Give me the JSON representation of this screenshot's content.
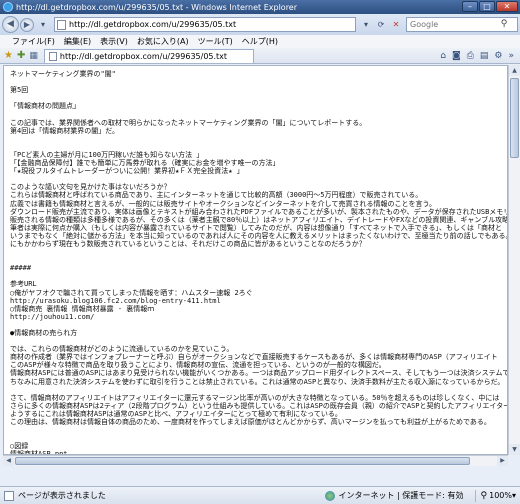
{
  "window": {
    "title": "http://dl.getdropbox.com/u/299635/05.txt - Windows Internet Explorer"
  },
  "address": {
    "url": "http://dl.getdropbox.com/u/299635/05.txt",
    "search_placeholder": "Google"
  },
  "menu": [
    "ファイル(F)",
    "編集(E)",
    "表示(V)",
    "お気に入り(A)",
    "ツール(T)",
    "ヘルプ(H)"
  ],
  "tab": {
    "label": "http://dl.getdropbox.com/u/299635/05.txt"
  },
  "document": {
    "lines": [
      "ネットマーケティング業界の\"闇\"",
      "",
      "第5回",
      "",
      "「情報商材の問題点」",
      "",
      "この記事では、業界関係者への取材で明らかになったネットマーケティング業界の「闇」についてレポートする。",
      "第4回は「情報商材業界の闇」だ。",
      "",
      "",
      "「PCど素人の主婦が月に100万円稼いだ誰も知らない方法 」",
      "「【金融商品保障付】誰でも簡単に万馬券が取れる（確実にお金を増やす唯一の方法」",
      "「★現役フルタイムトレーダーがついに公開！業界初★ＦＸ完全投資法★ 」",
      "",
      "このような謳い文句を見かけた事はないだろうか？",
      "これらは情報商材と呼ばれている商品であり、主にインターネットを通じて比較的高額（3000円～5万円程度）で販売されている。",
      "広義では書籍も情報商材と言えるが、一般的には販売サイトやオークションなどインターネットを介して売買される情報のことを言う。",
      "ダウンロード販売が主流であり、実体は画像とテキストが組み合わされたPDFファイルであることが多いが、製本されたものや、データが保存されたUSBメモリやCD",
      "販売される情報の種類は多種多様であるが、その多くは（薬者主観で80％以上）はネットアフィリエイト、デイトレードやFXなどの投資関連、ギャンブル攻略方法",
      "筆者は実際に何点か購入（もしくは内容が暴露されているサイトで閲覧）してみたのだが、内容は想像通り「すべてネットで入手できる」、もしくは「商材と",
      "いうまでもなく「絶対に儲かる方法」を本当に知っているのであれば人にその内容を人に教えるメリットはまったくないわけで、至極当たり前の話しでもある。",
      "にもかかわらず現在もう数販売されているということは、それだけこの商品に皆があるということなのだろうか？",
      "",
      "",
      "#####",
      "",
      "参考URL",
      "○俺がヤフオクで騙されて買ってしまった情報を晒す：ハムスター速報 2ろぐ",
      "http://urasoku.blog106.fc2.com/blog-entry-411.html",
      "○情報商売 裏情報 情報商材暴露 - 裏情報ｍ",
      "http://jouhou11.com/",
      "",
      "●情報商材の売られ方",
      "",
      "では、これらの情報商材がどのように流通しているのかを見ていこう。",
      "商材の作成者（業界ではインフォプレーナーと呼ぶ）自らがオークションなどで直接販売するケースもあるが、多くは情報商材専門のASP（アフィリエイト",
      "このASPが様々な特徴で商品を取り扱うことにより、情報商材の宣伝、流通を担っている、というのが一般的な構図だ。",
      "情報商材ASPには普通のASPにはあまり見受けられない機能がいくつかある。一つは商品アップロード用ダイレクトスペース、そしてもう一つは決済システムで",
      "ちなみに用意された決済システムを使わずに取引を行うことは禁止されている。これは通常のASPと異なり、決済手数料が主たる収入源になっているからだ。",
      "",
      "さて、情報商材のアフィリエイトはアフィリエイターに還元するマージン比率が高いのが大きな特徴となっている。50％を超えるものは珍しくなく、中には",
      "さらに多くの情報商材ASPは2ティア（2段階プログラム）という仕組みも提供している。これはASPの既存会員（親）の紹介でASPと契約したアフィリエイター",
      "ようするにこれは情報商材ASPは通常のASPと比べ、アフィリエイターにとって極めて有利になっている。",
      "この理由は、情報商材は情報自体の商品のため、一度商材を作ってしまえば原価がほとんどかからず、高いマージンを払っても利益が上がるためである。",
      "",
      "",
      "○図録",
      "情報商材ASP.ppt",
      "",
      "",
      "●テンプレート化された販売サイト"
    ]
  },
  "status": {
    "text": "ページが表示されました",
    "zone": "インターネット | 保護モード: 有効",
    "zoom": "100%"
  }
}
